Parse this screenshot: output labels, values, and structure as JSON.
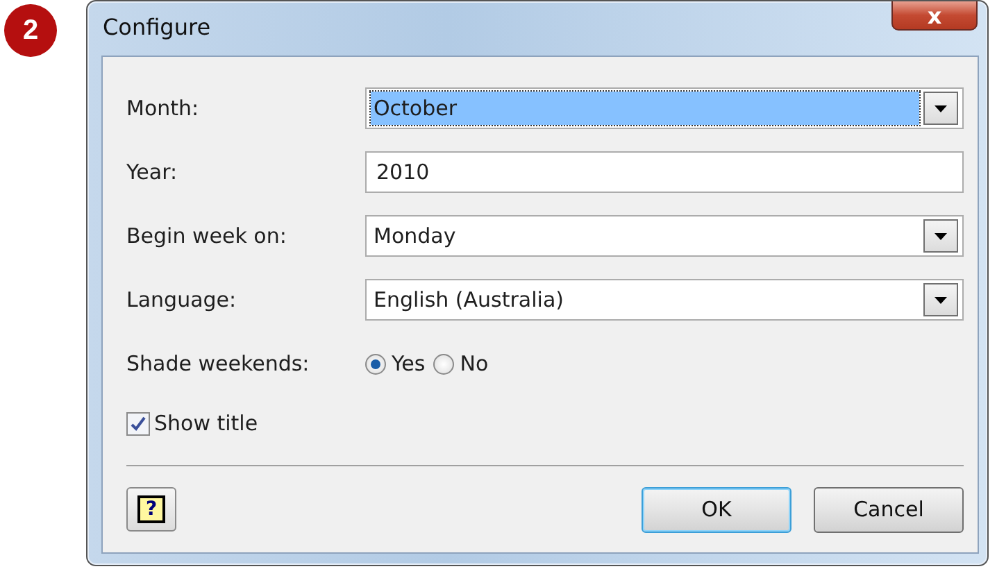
{
  "step_badge": "2",
  "window": {
    "title": "Configure",
    "close": "x"
  },
  "fields": [
    {
      "kind": "combo",
      "label": "Month:",
      "value": "October",
      "focused": true
    },
    {
      "kind": "text",
      "label": "Year:",
      "value": "2010",
      "focused": false
    },
    {
      "kind": "combo",
      "label": "Begin week on:",
      "value": "Monday",
      "focused": false
    },
    {
      "kind": "combo",
      "label": "Language:",
      "value": "English (Australia)",
      "focused": false
    },
    {
      "kind": "radio",
      "label": "Shade weekends:",
      "options": [
        {
          "label": "Yes",
          "selected": true
        },
        {
          "label": "No",
          "selected": false
        }
      ]
    }
  ],
  "show_title": {
    "label": "Show title",
    "checked": true
  },
  "help_button": "?",
  "buttons": [
    {
      "label": "OK",
      "default": true
    },
    {
      "label": "Cancel",
      "default": false
    }
  ]
}
